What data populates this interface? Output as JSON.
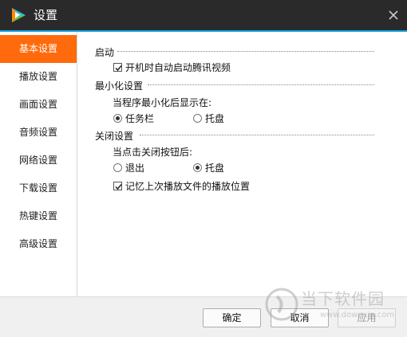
{
  "window": {
    "title": "设置",
    "icons": {
      "logo": "tencent-video-logo",
      "close": "close-icon"
    }
  },
  "sidebar": {
    "items": [
      {
        "label": "基本设置",
        "active": true
      },
      {
        "label": "播放设置",
        "active": false
      },
      {
        "label": "画面设置",
        "active": false
      },
      {
        "label": "音频设置",
        "active": false
      },
      {
        "label": "网络设置",
        "active": false
      },
      {
        "label": "下载设置",
        "active": false
      },
      {
        "label": "热键设置",
        "active": false
      },
      {
        "label": "高级设置",
        "active": false
      }
    ]
  },
  "startup": {
    "title": "启动",
    "autostart_label": "开机时自动启动腾讯视频",
    "autostart_checked": true
  },
  "minimize": {
    "title": "最小化设置",
    "prompt": "当程序最小化后显示在:",
    "options": [
      {
        "label": "任务栏",
        "checked": true
      },
      {
        "label": "托盘",
        "checked": false
      }
    ]
  },
  "close": {
    "title": "关闭设置",
    "prompt": "当点击关闭按钮后:",
    "options": [
      {
        "label": "退出",
        "checked": false
      },
      {
        "label": "托盘",
        "checked": true
      }
    ],
    "remember_label": "记忆上次播放文件的播放位置",
    "remember_checked": true
  },
  "buttons": {
    "ok": "确定",
    "cancel": "取消",
    "apply": "应用"
  },
  "watermark": {
    "text": "当下软件园",
    "url": "www.downxia.com"
  },
  "colors": {
    "titlebar": "#2a2a2a",
    "accent_line": "#16a6e6",
    "active_item": "#ff6a0c"
  }
}
